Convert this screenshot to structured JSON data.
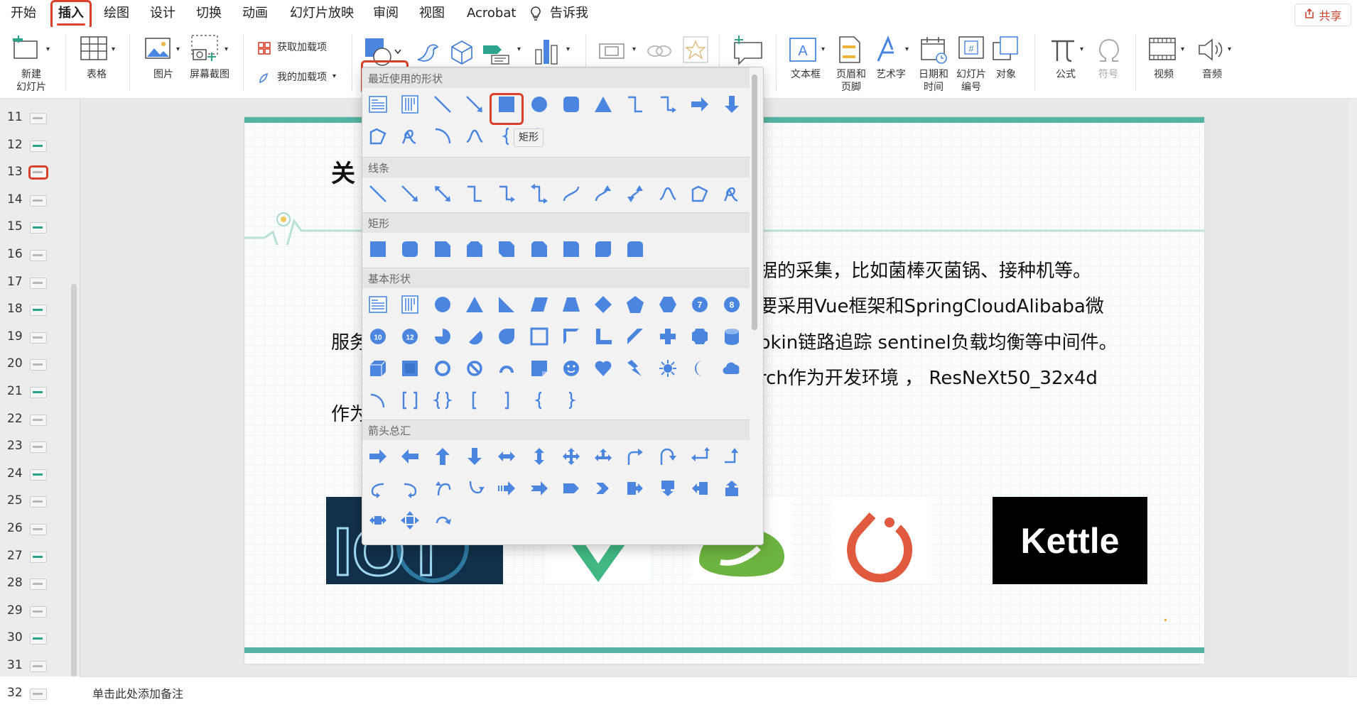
{
  "menu": {
    "tabs": [
      "开始",
      "插入",
      "绘图",
      "设计",
      "切换",
      "动画",
      "幻灯片放映",
      "审阅",
      "视图",
      "Acrobat",
      "告诉我"
    ],
    "active_tab": "插入",
    "share_label": "共享"
  },
  "ribbon": {
    "new_slide": "新建\n幻灯片",
    "table": "表格",
    "picture": "图片",
    "screenshot": "屏幕截图",
    "get_addins": "获取加载项",
    "my_addins": "我的加载项",
    "textbox": "文本框",
    "header_footer": "页眉和\n页脚",
    "wordart": "艺术字",
    "date_time": "日期和\n时间",
    "slide_number": "幻灯片\n编号",
    "object": "对象",
    "equation": "公式",
    "symbol": "符号",
    "video": "视频",
    "audio": "音频"
  },
  "thumbnails": [
    "11",
    "12",
    "13",
    "14",
    "15",
    "16",
    "17",
    "18",
    "19",
    "20",
    "21",
    "22",
    "23",
    "24",
    "25",
    "26",
    "27",
    "28",
    "29",
    "30",
    "31",
    "32"
  ],
  "slide": {
    "title_fragment": "关",
    "line1": "据的采集，比如菌棒灭菌锅、接种机等。",
    "line2": "要采用Vue框架和SpringCloudAlibaba微",
    "line3_left": "服务",
    "line3_right": "pkin链路追踪 sentinel负载均衡等中间件。",
    "line4": "rch作为开发环境 ， ResNeXt50_32x4d",
    "line5_left": "作为",
    "kettle_label": "Kettle"
  },
  "notes_placeholder": "单击此处添加备注",
  "dropdown": {
    "sections": [
      "最近使用的形状",
      "线条",
      "矩形",
      "基本形状",
      "箭头总汇"
    ],
    "tooltip": "矩形",
    "basic_numbers": [
      "7",
      "8",
      "10",
      "12"
    ]
  },
  "colors": {
    "accent": "#d9412b",
    "shape_blue": "#4a86e0",
    "teal": "#56b3a4"
  }
}
